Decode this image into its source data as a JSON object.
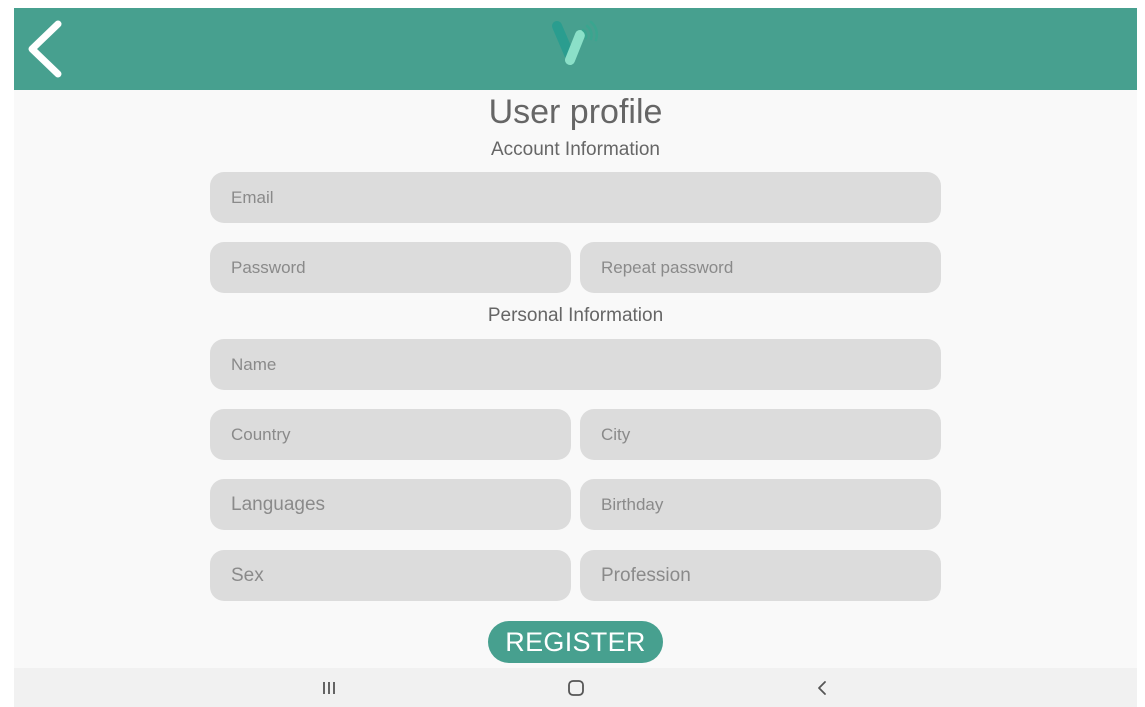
{
  "header": {
    "back_icon": "chevron-left-icon",
    "logo_icon": "app-logo-icon",
    "colors": {
      "primary": "#47a08f",
      "logo_dark": "#2a9d8f",
      "logo_light": "#8be0c8"
    }
  },
  "page": {
    "title": "User profile",
    "account_section": "Account Information",
    "personal_section": "Personal Information"
  },
  "fields": {
    "email": {
      "placeholder": "Email",
      "value": ""
    },
    "password": {
      "placeholder": "Password",
      "value": ""
    },
    "repeat_password": {
      "placeholder": "Repeat password",
      "value": ""
    },
    "name": {
      "placeholder": "Name",
      "value": ""
    },
    "country": {
      "placeholder": "Country",
      "value": ""
    },
    "city": {
      "placeholder": "City",
      "value": ""
    },
    "languages": {
      "placeholder": "Languages",
      "value": ""
    },
    "birthday": {
      "placeholder": "Birthday",
      "value": ""
    },
    "sex": {
      "placeholder": "Sex",
      "value": ""
    },
    "profession": {
      "placeholder": "Profession",
      "value": ""
    }
  },
  "actions": {
    "register_label": "REGISTER"
  },
  "system_nav": {
    "recents_icon": "recent-apps-icon",
    "home_icon": "home-icon",
    "back_icon": "back-icon"
  }
}
